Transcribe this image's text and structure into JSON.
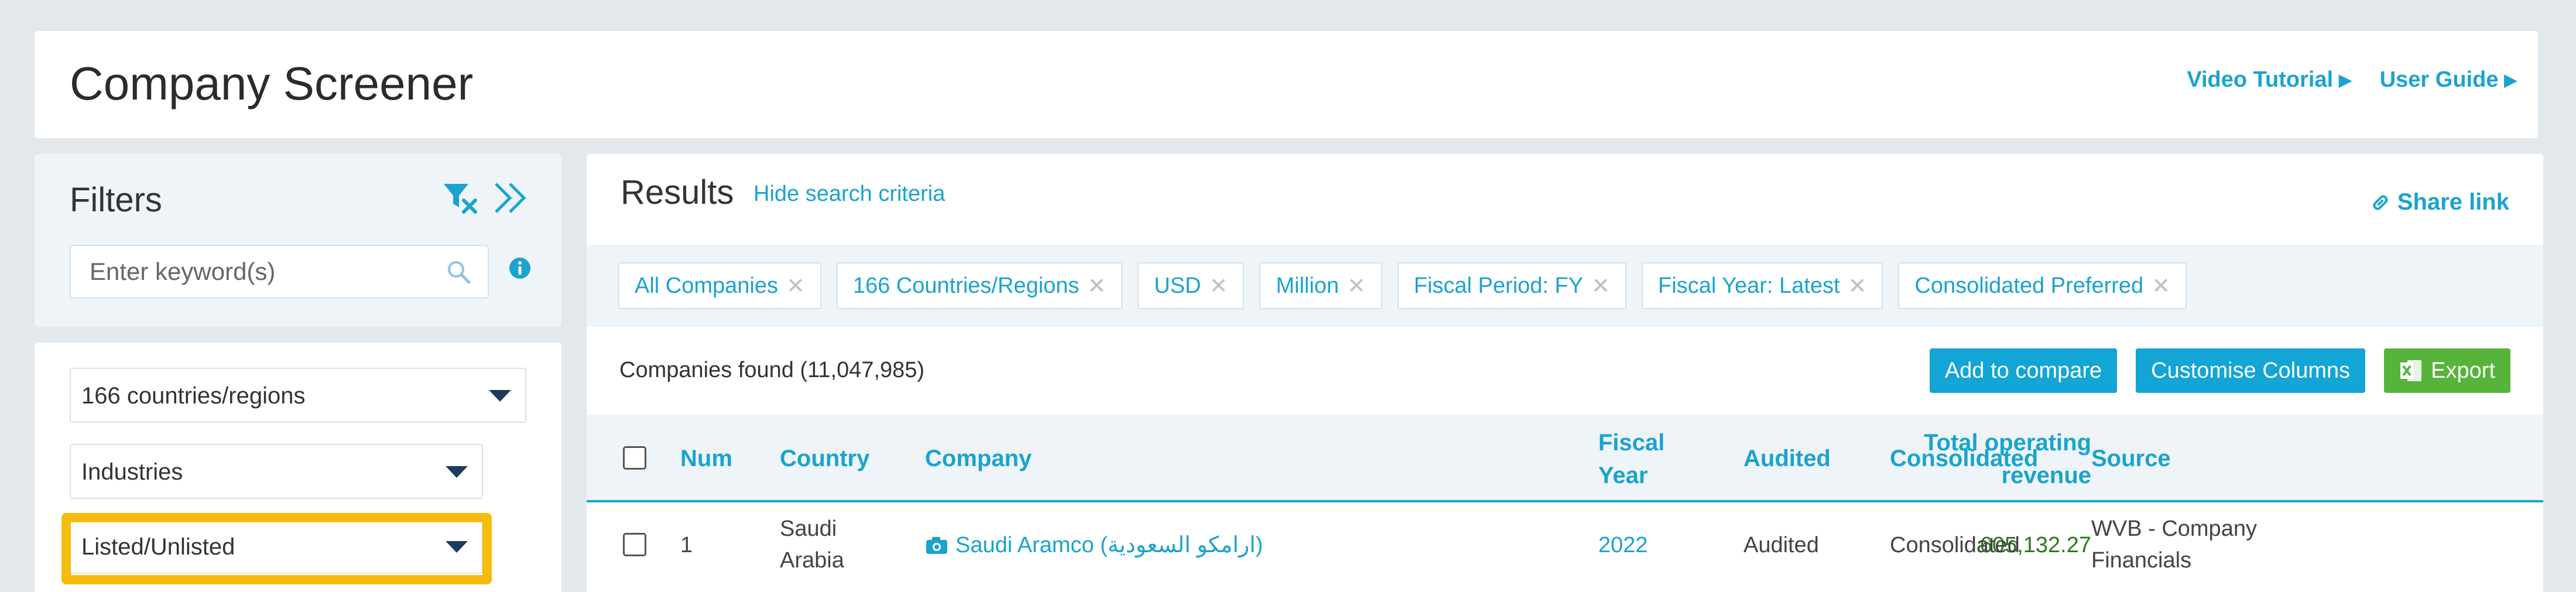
{
  "header": {
    "title": "Company Screener",
    "links": [
      {
        "label": "Video Tutorial"
      },
      {
        "label": "User Guide"
      }
    ]
  },
  "filters": {
    "title": "Filters",
    "keyword_placeholder": "Enter keyword(s)",
    "dropdowns": {
      "countries": "166 countries/regions",
      "industries": "Industries",
      "listed": "Listed/Unlisted"
    },
    "highlight_color": "#f6bc0c"
  },
  "results": {
    "title": "Results",
    "hide_criteria": "Hide search criteria",
    "share_link": "Share link",
    "chips": [
      "All Companies",
      "166 Countries/Regions",
      "USD",
      "Million",
      "Fiscal Period: FY",
      "Fiscal Year: Latest",
      "Consolidated Preferred"
    ],
    "companies_found": "Companies found (11,047,985)",
    "buttons": {
      "compare": "Add to compare",
      "customise": "Customise Columns",
      "export": "Export"
    },
    "columns": {
      "num": "Num",
      "country": "Country",
      "company": "Company",
      "revenue_line1": "Total operating",
      "revenue_line2": "revenue",
      "fiscal_line1": "Fiscal",
      "fiscal_line2": "Year",
      "audited": "Audited",
      "consolidated": "Consolidated",
      "source": "Source"
    },
    "rows": [
      {
        "num": "1",
        "country_line1": "Saudi",
        "country_line2": "Arabia",
        "company": "Saudi Aramco (ارامكو السعودية)",
        "revenue": "605,132.27",
        "fiscal_year": "2022",
        "audited": "Audited",
        "consolidated": "Consolidated",
        "source_line1": "WVB - Company",
        "source_line2": "Financials"
      }
    ]
  },
  "colors": {
    "accent": "#1aa3cf",
    "button_blue": "#12a5d6",
    "button_green": "#56b43b",
    "revenue_green": "#2a7a1a"
  }
}
